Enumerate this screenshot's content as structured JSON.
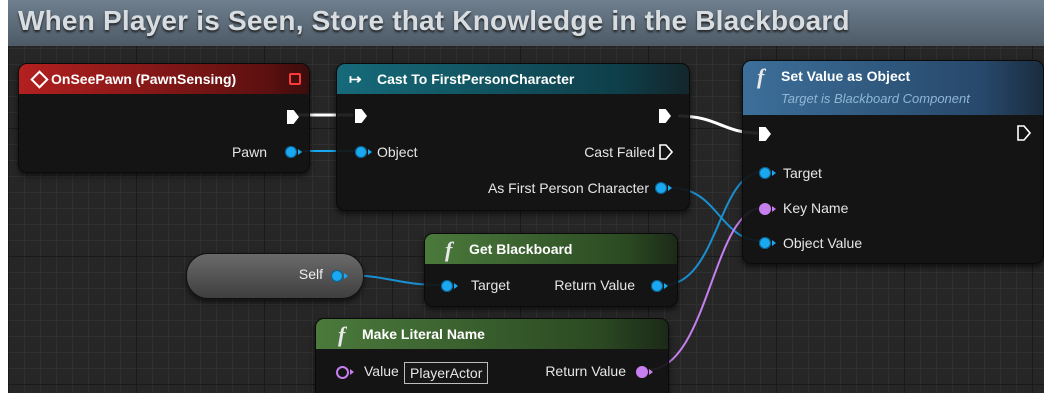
{
  "comment": {
    "title": "When Player is Seen, Store that Knowledge in the Blackboard"
  },
  "nodes": {
    "on_see_pawn": {
      "title": "OnSeePawn (PawnSensing)",
      "pins": {
        "pawn": "Pawn"
      }
    },
    "cast": {
      "title": "Cast To FirstPersonCharacter",
      "pins": {
        "object": "Object",
        "cast_failed": "Cast Failed",
        "as_character": "As First Person Character"
      }
    },
    "set_value": {
      "title": "Set Value as Object",
      "subtitle": "Target is Blackboard Component",
      "pins": {
        "target": "Target",
        "key_name": "Key Name",
        "object_value": "Object Value"
      }
    },
    "get_blackboard": {
      "title": "Get Blackboard",
      "pins": {
        "target": "Target",
        "return_value": "Return Value"
      }
    },
    "self_var": {
      "label": "Self"
    },
    "make_literal": {
      "title": "Make Literal Name",
      "pins": {
        "value": "Value",
        "value_input": "PlayerActor",
        "return_value": "Return Value"
      }
    }
  },
  "icons": {
    "event": "diamond-icon",
    "function": "f-function-icon",
    "cast": "cast-arrows-icon",
    "stop": "red-square-icon"
  },
  "colors": {
    "object_pin": "#1aa8f0",
    "name_pin": "#c77ff0",
    "exec_pin": "#ffffff",
    "event_header": "#b32020",
    "cast_header": "#166a7a",
    "pure_header": "#4b7a3c",
    "function_header": "#3c6f9a"
  }
}
